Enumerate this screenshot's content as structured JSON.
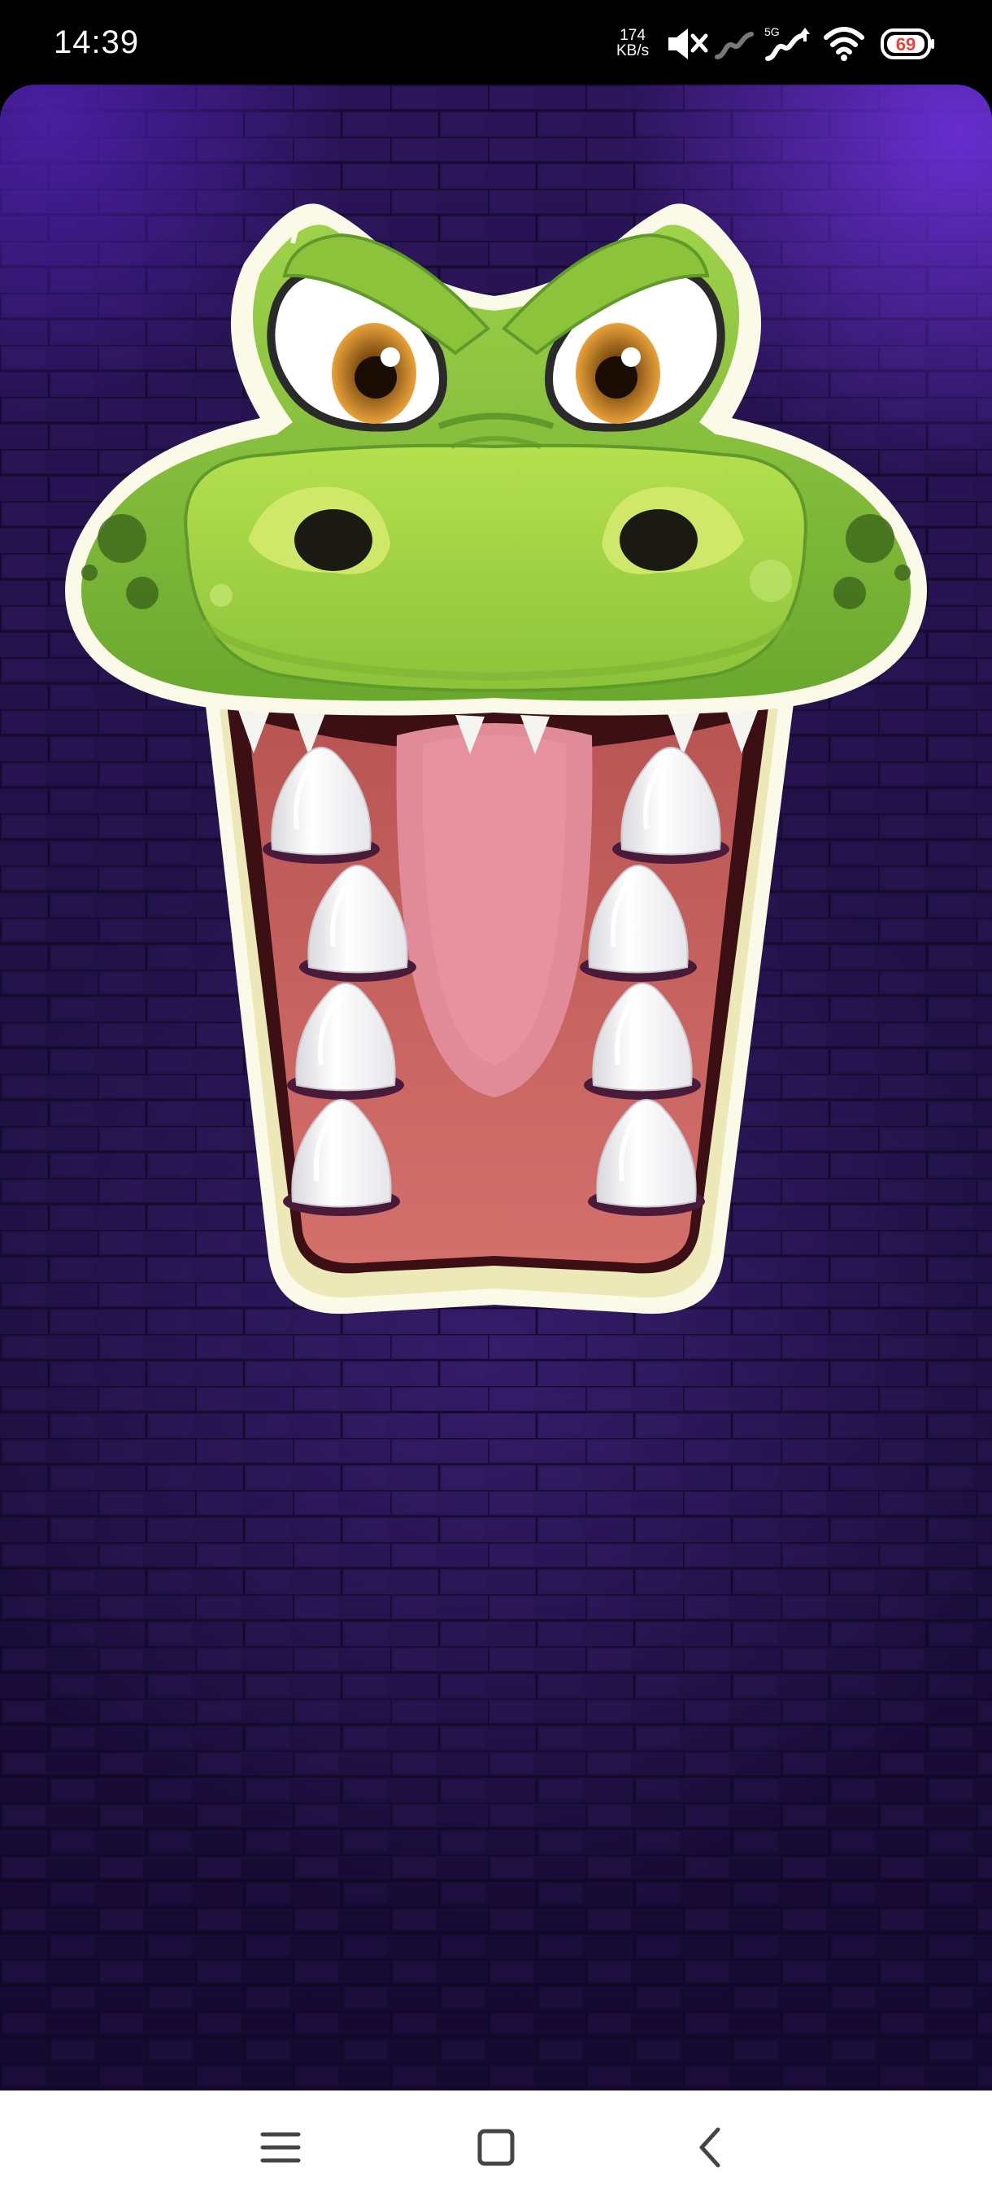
{
  "status_bar": {
    "time": "14:39",
    "net_speed_value": "174",
    "net_speed_unit": "KB/s",
    "network_type": "5G",
    "battery": "69",
    "icons": [
      "mute-icon",
      "signal-icon",
      "signal-5g-icon",
      "wifi-icon",
      "battery-icon"
    ]
  },
  "game": {
    "character": "crocodile",
    "teeth_count": 8,
    "colors": {
      "background": "#1c0f3c",
      "glow": "#6a2fd6",
      "skin": "#7fbf3a",
      "skin_light": "#a6d64a",
      "mouth": "#cd6a68",
      "tongue": "#e28b98",
      "tooth": "#ffffff",
      "outline": "#fbf9e8"
    }
  },
  "nav_bar": {
    "buttons": [
      "menu-icon",
      "home-icon",
      "back-icon"
    ]
  }
}
